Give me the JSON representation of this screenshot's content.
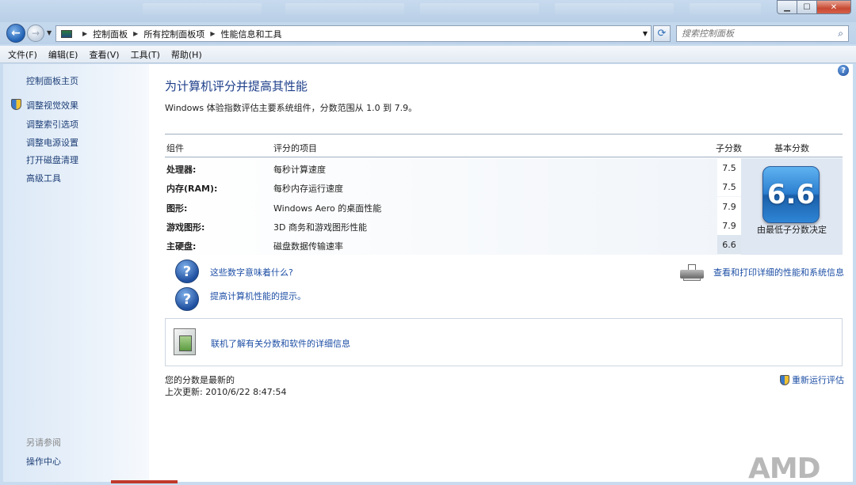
{
  "window": {
    "minimize": "▁",
    "maximize": "☐",
    "close": "✕"
  },
  "address": {
    "crumbs": [
      "控制面板",
      "所有控制面板项",
      "性能信息和工具"
    ],
    "search_placeholder": "搜索控制面板"
  },
  "menu": [
    "文件(F)",
    "编辑(E)",
    "查看(V)",
    "工具(T)",
    "帮助(H)"
  ],
  "sidebar": {
    "home": "控制面板主页",
    "items": [
      "调整视觉效果",
      "调整索引选项",
      "调整电源设置",
      "打开磁盘清理",
      "高级工具"
    ],
    "see_also_title": "另请参阅",
    "see_also_items": [
      "操作中心"
    ]
  },
  "main": {
    "title": "为计算机评分并提高其性能",
    "subtitle": "Windows 体验指数评估主要系统组件，分数范围从 1.0 到 7.9。",
    "table": {
      "headers": [
        "组件",
        "评分的项目",
        "子分数",
        "基本分数"
      ],
      "rows": [
        {
          "component": "处理器:",
          "item": "每秒计算速度",
          "score": "7.5"
        },
        {
          "component": "内存(RAM):",
          "item": "每秒内存运行速度",
          "score": "7.5"
        },
        {
          "component": "图形:",
          "item": "Windows Aero 的桌面性能",
          "score": "7.9"
        },
        {
          "component": "游戏图形:",
          "item": "3D 商务和游戏图形性能",
          "score": "7.9"
        },
        {
          "component": "主硬盘:",
          "item": "磁盘数据传输速率",
          "score": "6.6"
        }
      ],
      "base_score": "6.6",
      "base_caption": "由最低子分数决定"
    },
    "links": {
      "what_mean": "这些数字意味着什么?",
      "tips": "提高计算机性能的提示。",
      "print": "查看和打印详细的性能和系统信息",
      "online": "联机了解有关分数和软件的详细信息"
    },
    "status": "您的分数是最新的",
    "last_update": "上次更新: 2010/6/22 8:47:54",
    "rerun": "重新运行评估"
  },
  "brand": "AMD"
}
